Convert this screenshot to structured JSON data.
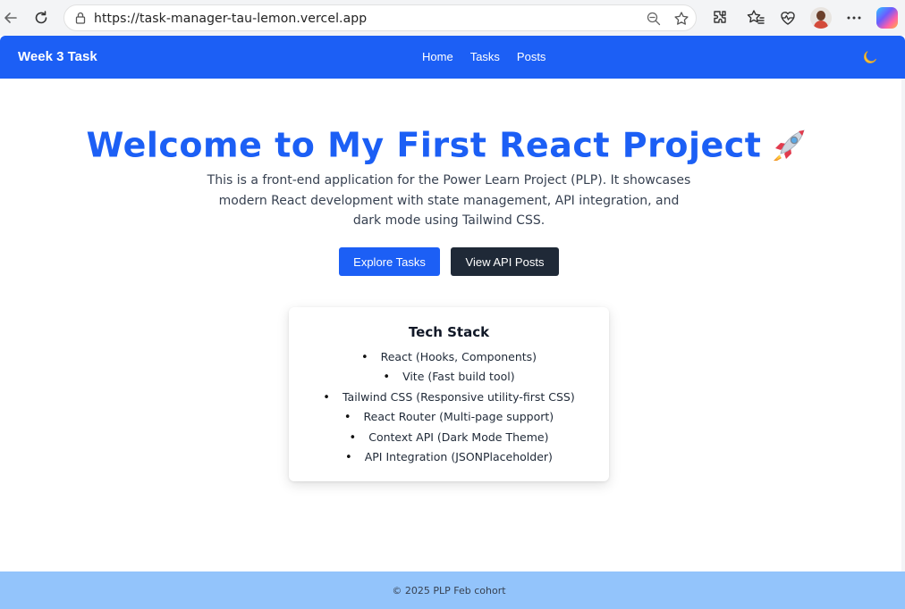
{
  "browser": {
    "url": "https://task-manager-tau-lemon.vercel.app"
  },
  "navbar": {
    "brand": "Week 3 Task",
    "links": [
      "Home",
      "Tasks",
      "Posts"
    ],
    "theme_icon": "moon-icon"
  },
  "hero": {
    "title": "Welcome to My First React Project",
    "title_emoji": "rocket-icon",
    "description": "This is a front-end application for the Power Learn Project (PLP). It showcases modern React development with state management, API integration, and dark mode using Tailwind CSS.",
    "primary_button": "Explore Tasks",
    "secondary_button": "View API Posts"
  },
  "tech_stack": {
    "title": "Tech Stack",
    "items": [
      "React (Hooks, Components)",
      "Vite (Fast build tool)",
      "Tailwind CSS (Responsive utility-first CSS)",
      "React Router (Multi-page support)",
      "Context API (Dark Mode Theme)",
      "API Integration (JSONPlaceholder)"
    ]
  },
  "footer": {
    "text": "© 2025 PLP Feb cohort"
  },
  "colors": {
    "primary": "#1c5ff5",
    "dark_button": "#1f2937",
    "footer_bg": "#93c4fb"
  }
}
